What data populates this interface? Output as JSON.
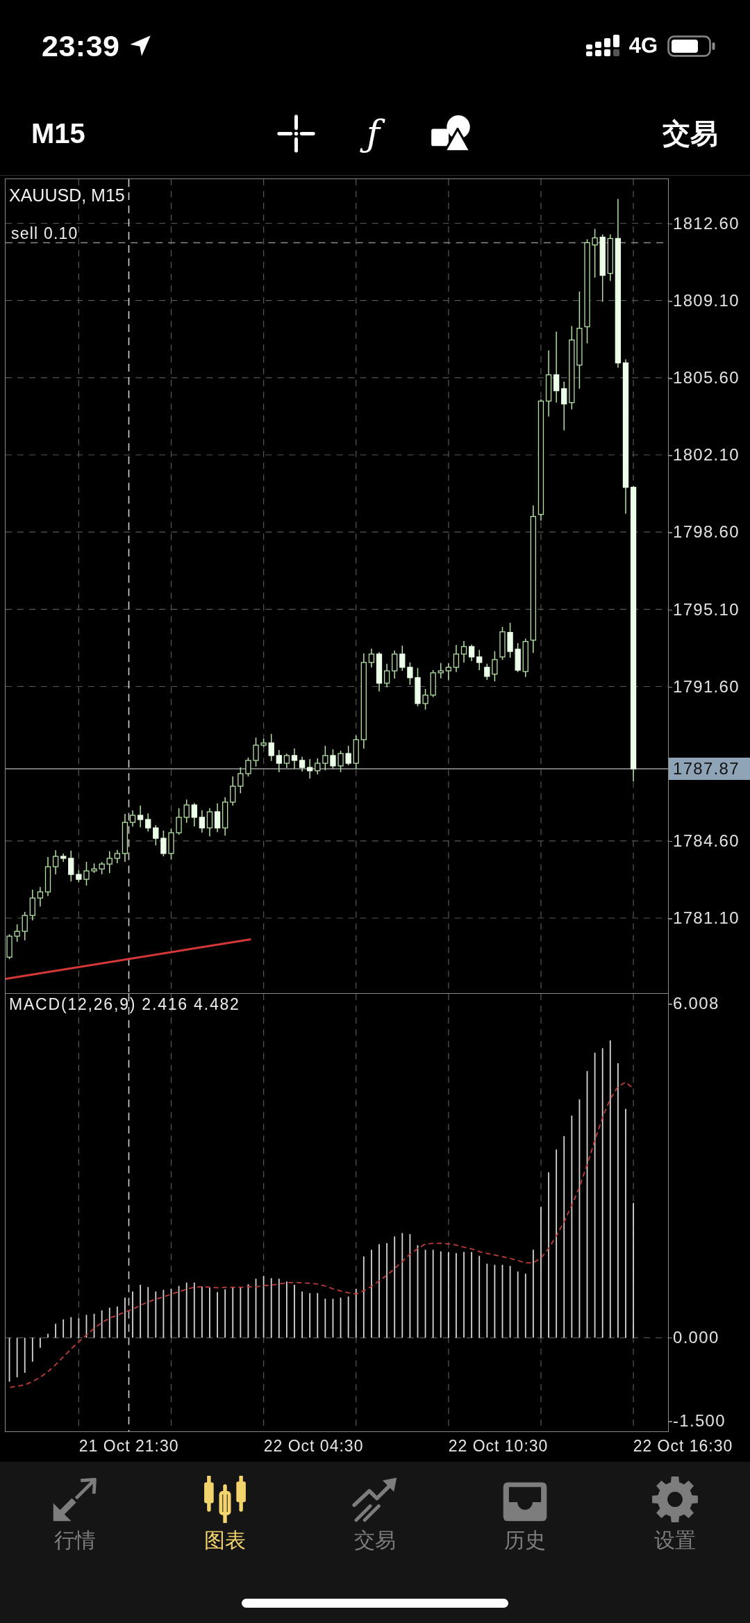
{
  "status_bar": {
    "time": "23:39",
    "network": "4G"
  },
  "toolbar": {
    "timeframe": "M15",
    "function_button": "ƒ",
    "trade_button": "交易"
  },
  "chart": {
    "chart_data": {
      "type": "candlestick",
      "title": "XAUUSD, M15",
      "categories": [
        null,
        null,
        null,
        null,
        null,
        null,
        null,
        null,
        null,
        null,
        null,
        null,
        null,
        null,
        null,
        null,
        null,
        null,
        null,
        null,
        null,
        null,
        null,
        null,
        null,
        null,
        null,
        null,
        null,
        null,
        null,
        null,
        null,
        null,
        null,
        null,
        null,
        null,
        null,
        null,
        null,
        null,
        null,
        null,
        null,
        null,
        null,
        null,
        null,
        null,
        null,
        null,
        null,
        null,
        null,
        null,
        null,
        null,
        null,
        null,
        null,
        null,
        null,
        null,
        null,
        null,
        null,
        null,
        null,
        null,
        null,
        null,
        null,
        null,
        null,
        null,
        null,
        null,
        null,
        null,
        null,
        null,
        null,
        null,
        null,
        null
      ],
      "ylim": [
        1777.7,
        1814.6
      ],
      "yticks": [
        {
          "value": 1812.6,
          "label": "1812.60"
        },
        {
          "value": 1809.1,
          "label": "1809.10"
        },
        {
          "value": 1805.6,
          "label": "1805.60"
        },
        {
          "value": 1802.1,
          "label": "1802.10"
        },
        {
          "value": 1798.6,
          "label": "1798.60"
        },
        {
          "value": 1795.1,
          "label": "1795.10"
        },
        {
          "value": 1791.6,
          "label": "1791.60"
        },
        {
          "value": 1784.6,
          "label": "1784.60"
        },
        {
          "value": 1781.1,
          "label": "1781.10"
        }
      ],
      "grid": true,
      "ohlc": [
        [
          1779.33,
          1780.37,
          1779.24,
          1780.28
        ],
        [
          1780.28,
          1780.82,
          1780.03,
          1780.5
        ],
        [
          1780.5,
          1781.38,
          1780.09,
          1781.22
        ],
        [
          1781.22,
          1782.39,
          1781.0,
          1782.01
        ],
        [
          1782.01,
          1782.51,
          1781.63,
          1782.29
        ],
        [
          1782.29,
          1783.87,
          1782.1,
          1783.43
        ],
        [
          1783.43,
          1784.18,
          1783.08,
          1783.9
        ],
        [
          1783.9,
          1784.03,
          1783.65,
          1783.81
        ],
        [
          1783.81,
          1784.16,
          1782.76,
          1783.08
        ],
        [
          1783.08,
          1783.27,
          1782.73,
          1782.86
        ],
        [
          1782.86,
          1783.65,
          1782.58,
          1783.24
        ],
        [
          1783.24,
          1783.58,
          1783.15,
          1783.33
        ],
        [
          1783.33,
          1783.64,
          1783.08,
          1783.55
        ],
        [
          1783.55,
          1784.13,
          1783.14,
          1783.81
        ],
        [
          1783.81,
          1784.19,
          1783.59,
          1784.03
        ],
        [
          1784.03,
          1785.82,
          1783.65,
          1785.44
        ],
        [
          1785.44,
          1785.98,
          1785.25,
          1785.76
        ],
        [
          1785.76,
          1786.2,
          1785.22,
          1785.57
        ],
        [
          1785.57,
          1785.85,
          1785.03,
          1785.19
        ],
        [
          1785.19,
          1785.32,
          1784.4,
          1784.72
        ],
        [
          1784.72,
          1785.07,
          1783.9,
          1784.03
        ],
        [
          1784.03,
          1785.16,
          1783.75,
          1784.97
        ],
        [
          1784.97,
          1786.08,
          1784.88,
          1785.67
        ],
        [
          1785.67,
          1786.48,
          1785.42,
          1786.23
        ],
        [
          1786.23,
          1786.32,
          1785.26,
          1785.67
        ],
        [
          1785.67,
          1785.99,
          1784.97,
          1785.19
        ],
        [
          1785.19,
          1786.08,
          1784.81,
          1785.92
        ],
        [
          1785.92,
          1786.3,
          1785.0,
          1785.19
        ],
        [
          1785.19,
          1786.58,
          1784.84,
          1786.36
        ],
        [
          1786.36,
          1787.52,
          1786.2,
          1787.08
        ],
        [
          1787.08,
          1787.93,
          1786.76,
          1787.65
        ],
        [
          1787.65,
          1788.38,
          1787.52,
          1788.25
        ],
        [
          1788.25,
          1789.29,
          1787.97,
          1788.94
        ],
        [
          1788.94,
          1789.23,
          1788.85,
          1789.04
        ],
        [
          1789.04,
          1789.45,
          1788.22,
          1788.47
        ],
        [
          1788.47,
          1788.72,
          1787.71,
          1788.12
        ],
        [
          1788.12,
          1788.56,
          1787.9,
          1788.47
        ],
        [
          1788.47,
          1788.79,
          1787.87,
          1788.25
        ],
        [
          1788.25,
          1788.41,
          1787.74,
          1787.93
        ],
        [
          1787.93,
          1788.31,
          1787.43,
          1787.78
        ],
        [
          1787.78,
          1788.34,
          1787.62,
          1788.12
        ],
        [
          1788.12,
          1788.91,
          1787.8,
          1788.47
        ],
        [
          1788.47,
          1788.75,
          1787.87,
          1788.0
        ],
        [
          1788.0,
          1788.69,
          1787.72,
          1788.56
        ],
        [
          1788.56,
          1788.91,
          1788.03,
          1788.12
        ],
        [
          1788.12,
          1789.38,
          1787.87,
          1789.19
        ],
        [
          1789.19,
          1793.1,
          1788.78,
          1792.69
        ],
        [
          1792.69,
          1793.32,
          1792.47,
          1793.07
        ],
        [
          1793.07,
          1793.16,
          1791.37,
          1791.75
        ],
        [
          1791.75,
          1792.63,
          1791.56,
          1792.31
        ],
        [
          1792.31,
          1793.23,
          1791.96,
          1793.07
        ],
        [
          1793.07,
          1793.45,
          1792.31,
          1792.47
        ],
        [
          1792.47,
          1792.69,
          1791.68,
          1792.0
        ],
        [
          1792.0,
          1792.44,
          1790.7,
          1790.83
        ],
        [
          1790.83,
          1791.49,
          1790.55,
          1791.21
        ],
        [
          1791.21,
          1792.35,
          1791.12,
          1792.22
        ],
        [
          1792.22,
          1792.66,
          1791.97,
          1792.31
        ],
        [
          1792.31,
          1792.66,
          1791.9,
          1792.47
        ],
        [
          1792.47,
          1793.48,
          1792.25,
          1793.07
        ],
        [
          1793.07,
          1793.66,
          1792.69,
          1793.41
        ],
        [
          1793.41,
          1793.5,
          1792.75,
          1792.94
        ],
        [
          1792.94,
          1793.26,
          1792.34,
          1792.69
        ],
        [
          1792.47,
          1792.63,
          1791.9,
          1792.06
        ],
        [
          1792.16,
          1793.2,
          1791.84,
          1792.82
        ],
        [
          1792.94,
          1794.3,
          1792.81,
          1794.08
        ],
        [
          1794.05,
          1794.49,
          1792.91,
          1793.19
        ],
        [
          1793.29,
          1793.57,
          1792.25,
          1792.34
        ],
        [
          1792.28,
          1793.77,
          1792.03,
          1793.64
        ],
        [
          1793.7,
          1799.81,
          1793.13,
          1799.31
        ],
        [
          1799.4,
          1804.63,
          1799.12,
          1804.54
        ],
        [
          1804.54,
          1806.84,
          1803.84,
          1805.73
        ],
        [
          1805.73,
          1807.69,
          1804.47,
          1805.01
        ],
        [
          1805.1,
          1805.42,
          1803.21,
          1804.41
        ],
        [
          1804.47,
          1807.94,
          1804.16,
          1807.31
        ],
        [
          1806.17,
          1809.51,
          1805.1,
          1807.84
        ],
        [
          1807.91,
          1811.88,
          1807.15,
          1811.72
        ],
        [
          1811.62,
          1812.35,
          1810.14,
          1811.94
        ],
        [
          1811.97,
          1812.1,
          1809.04,
          1810.24
        ],
        [
          1810.33,
          1812.1,
          1809.99,
          1811.91
        ],
        [
          1811.91,
          1813.7,
          1806.05,
          1806.27
        ],
        [
          1806.27,
          1806.43,
          1799.43,
          1800.63
        ],
        [
          1800.63,
          1800.69,
          1787.3,
          1787.87
        ],
        null,
        null,
        null,
        null
      ],
      "ref_lines": [
        {
          "axis": "y",
          "value": 1811.72,
          "label": "sell 0.10",
          "line_style": "dashed"
        },
        {
          "axis": "y",
          "value": 1787.87,
          "label": "1787.87",
          "line_style": "solid"
        }
      ]
    }
  },
  "indicator": {
    "histogram": {
      "chart_data": {
        "type": "bar",
        "title": "MACD(12,26,9) 2.416 4.482",
        "categories": [
          null,
          null,
          null,
          null,
          null,
          null,
          null,
          null,
          null,
          null,
          null,
          null,
          null,
          null,
          null,
          null,
          null,
          null,
          null,
          null,
          null,
          null,
          null,
          null,
          null,
          null,
          null,
          null,
          null,
          null,
          null,
          null,
          null,
          null,
          null,
          null,
          null,
          null,
          null,
          null,
          null,
          null,
          null,
          null,
          null,
          null,
          null,
          null,
          null,
          null,
          null,
          null,
          null,
          null,
          null,
          null,
          null,
          null,
          null,
          null,
          null,
          null,
          null,
          null,
          null,
          null,
          null,
          null,
          null,
          null,
          null,
          null,
          null,
          null,
          null,
          null,
          null,
          null,
          null,
          null,
          null,
          null,
          null,
          null,
          null,
          null
        ],
        "ylim": [
          -1.681,
          6.177
        ],
        "yticks": [
          {
            "value": 6.008,
            "label": "6.008"
          },
          {
            "value": 0,
            "label": "0.000"
          },
          {
            "value": -1.5,
            "label": "-1.500"
          }
        ],
        "grid": true,
        "ref_lines": [
          {
            "axis": "y",
            "value": 0,
            "line_style": "dashed"
          }
        ],
        "series": [
          {
            "color": "#d6d6d6",
            "values": [
              -0.79,
              -0.71,
              -0.63,
              -0.43,
              -0.18,
              0.07,
              0.25,
              0.33,
              0.37,
              0.35,
              0.41,
              0.43,
              0.49,
              0.54,
              0.56,
              0.72,
              0.83,
              0.95,
              0.91,
              0.83,
              0.86,
              0.88,
              0.93,
              0.99,
              0.99,
              0.92,
              0.9,
              0.82,
              0.87,
              0.9,
              0.9,
              0.96,
              1.06,
              1.11,
              1.07,
              1.06,
              1.01,
              0.95,
              0.83,
              0.8,
              0.8,
              0.7,
              0.7,
              0.72,
              0.74,
              0.88,
              1.46,
              1.58,
              1.68,
              1.7,
              1.82,
              1.88,
              1.86,
              1.66,
              1.58,
              1.58,
              1.55,
              1.54,
              1.52,
              1.54,
              1.54,
              1.47,
              1.33,
              1.31,
              1.31,
              1.29,
              1.19,
              1.15,
              1.58,
              2.35,
              2.97,
              3.38,
              3.62,
              3.99,
              4.28,
              4.79,
              5.12,
              5.2,
              5.34,
              4.93,
              4.11,
              2.42,
              null,
              null,
              null,
              null
            ]
          }
        ]
      }
    },
    "signal": {
      "chart_data": {
        "type": "line",
        "categories": [
          null,
          null,
          null,
          null,
          null,
          null,
          null,
          null,
          null,
          null,
          null,
          null,
          null,
          null,
          null,
          null,
          null,
          null,
          null,
          null,
          null,
          null,
          null,
          null,
          null,
          null,
          null,
          null,
          null,
          null,
          null,
          null,
          null,
          null,
          null,
          null,
          null,
          null,
          null,
          null,
          null,
          null,
          null,
          null,
          null,
          null,
          null,
          null,
          null,
          null,
          null,
          null,
          null,
          null,
          null,
          null,
          null,
          null,
          null,
          null,
          null,
          null,
          null,
          null,
          null,
          null,
          null,
          null,
          null,
          null,
          null,
          null,
          null,
          null,
          null,
          null,
          null,
          null,
          null,
          null,
          null,
          null,
          null,
          null,
          null,
          null
        ],
        "ylim": [
          -1.681,
          6.177
        ],
        "series": [
          {
            "color": "#c43c3c",
            "line_style": "dashed",
            "values": [
              -0.89,
              -0.87,
              -0.84,
              -0.78,
              -0.7,
              -0.6,
              -0.47,
              -0.33,
              -0.19,
              -0.06,
              0.06,
              0.18,
              0.28,
              0.36,
              0.41,
              0.47,
              0.52,
              0.59,
              0.65,
              0.7,
              0.74,
              0.79,
              0.83,
              0.88,
              0.91,
              0.92,
              0.91,
              0.9,
              0.91,
              0.91,
              0.91,
              0.92,
              0.92,
              0.94,
              0.95,
              0.97,
              0.99,
              1.0,
              0.99,
              0.98,
              0.97,
              0.93,
              0.88,
              0.84,
              0.81,
              0.79,
              0.85,
              0.93,
              1.03,
              1.13,
              1.25,
              1.38,
              1.51,
              1.61,
              1.69,
              1.7,
              1.7,
              1.69,
              1.67,
              1.63,
              1.6,
              1.55,
              1.52,
              1.49,
              1.46,
              1.43,
              1.39,
              1.35,
              1.35,
              1.44,
              1.61,
              1.84,
              2.09,
              2.39,
              2.72,
              3.12,
              3.56,
              3.97,
              4.3,
              4.52,
              4.6,
              4.48,
              null,
              null,
              null,
              null
            ]
          }
        ]
      }
    }
  },
  "time_axis": [
    "21 Oct 21:30",
    "22 Oct 04:30",
    "22 Oct 10:30",
    "22 Oct 16:30"
  ],
  "tab_bar": [
    {
      "label": "行情",
      "selected": false
    },
    {
      "label": "图表",
      "selected": true
    },
    {
      "label": "交易",
      "selected": false
    },
    {
      "label": "历史",
      "selected": false
    },
    {
      "label": "设置",
      "selected": false
    }
  ]
}
